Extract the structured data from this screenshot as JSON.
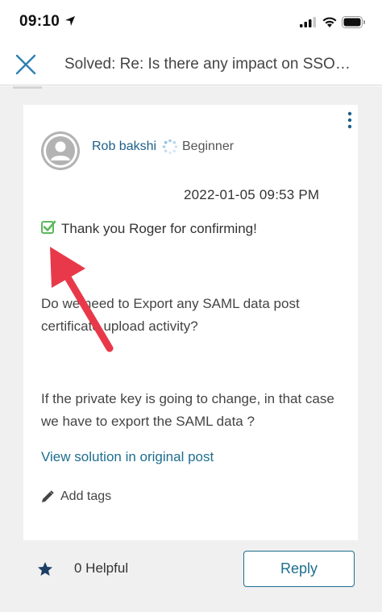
{
  "status_bar": {
    "time": "09:10"
  },
  "header": {
    "title": "Solved: Re: Is there any impact on SSO…"
  },
  "post": {
    "author": "Rob bakshi",
    "rank": "Beginner",
    "timestamp": "2022-01-05 09:53 PM",
    "confirmation_text": "Thank you Roger for confirming!",
    "paragraph_1": "Do we need to Export any SAML data post certificate upload activity?",
    "paragraph_2": "If the private key is going to change, in that case we have to export the SAML data ?",
    "solution_link": "View solution in original post",
    "add_tags_label": "Add tags"
  },
  "footer": {
    "helpful_label": "0 Helpful",
    "reply_label": "Reply"
  },
  "colors": {
    "link": "#1d6e8f",
    "check_green": "#5cb85c",
    "annotation_red": "#e8394a"
  },
  "icons": [
    "location-arrow-icon",
    "cellular-signal-icon",
    "wifi-icon",
    "battery-icon",
    "close-icon",
    "kebab-menu-icon",
    "user-avatar-icon",
    "rank-spinner-icon",
    "checkbox-checked-icon",
    "pencil-icon",
    "star-icon"
  ]
}
